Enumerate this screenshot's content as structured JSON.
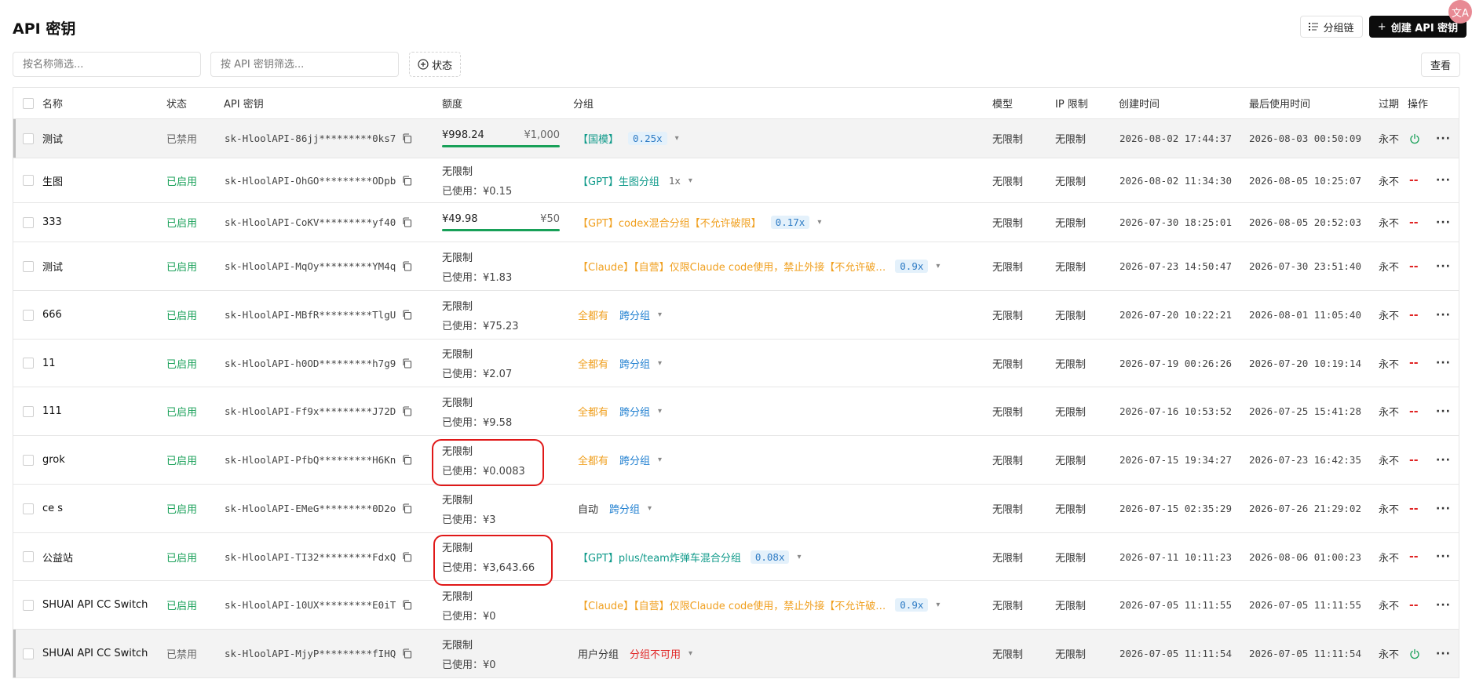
{
  "page": {
    "title": "API 密钥"
  },
  "toolbar": {
    "group_chain_label": "分组链",
    "create_label": "创建 API 密钥",
    "view_label": "查看",
    "translate_badge": "文A"
  },
  "filters": {
    "name_placeholder": "按名称筛选...",
    "key_placeholder": "按 API 密钥筛选...",
    "status_label": "状态"
  },
  "columns": [
    "名称",
    "状态",
    "API 密钥",
    "额度",
    "分组",
    "模型",
    "IP 限制",
    "创建时间",
    "最后使用时间",
    "过期",
    "操作"
  ],
  "rows": [
    {
      "name": "测试",
      "status": "已禁用",
      "enabled": false,
      "key": "sk-HloolAPI-86jj*********0ks7",
      "quota": {
        "mode": "bar",
        "remaining": "¥998.24",
        "total": "¥1,000",
        "fraction": 0.998
      },
      "group": {
        "parts": [
          {
            "text": "【国模】",
            "style": "teal"
          }
        ],
        "ratio": "0.25x",
        "ratio_style": "badge"
      },
      "model": "无限制",
      "ip": "无限制",
      "created": "2026-08-02 17:44:37",
      "last_used": "2026-08-03 00:50:09",
      "expires": "永不",
      "action": "power"
    },
    {
      "name": "生图",
      "status": "已启用",
      "enabled": true,
      "key": "sk-HloolAPI-OhGO*********ODpb",
      "quota": {
        "mode": "used",
        "limit": "无限制",
        "used": "已使用：¥0.15"
      },
      "group": {
        "parts": [
          {
            "text": "【GPT】生图分组",
            "style": "teal"
          }
        ],
        "ratio": "1x",
        "ratio_style": "plain"
      },
      "model": "无限制",
      "ip": "无限制",
      "created": "2026-08-02 11:34:30",
      "last_used": "2026-08-05 10:25:07",
      "expires": "永不",
      "action": "dash"
    },
    {
      "name": "333",
      "status": "已启用",
      "enabled": true,
      "key": "sk-HloolAPI-CoKV*********yf40",
      "quota": {
        "mode": "bar",
        "remaining": "¥49.98",
        "total": "¥50",
        "fraction": 0.9996
      },
      "group": {
        "parts": [
          {
            "text": "【GPT】codex混合分组【不允许破限】",
            "style": "orange"
          }
        ],
        "ratio": "0.17x",
        "ratio_style": "badge"
      },
      "model": "无限制",
      "ip": "无限制",
      "created": "2026-07-30 18:25:01",
      "last_used": "2026-08-05 20:52:03",
      "expires": "永不",
      "action": "dash"
    },
    {
      "name": "测试",
      "status": "已启用",
      "enabled": true,
      "key": "sk-HloolAPI-MqOy*********YM4q",
      "quota": {
        "mode": "used",
        "limit": "无限制",
        "used": "已使用：¥1.83"
      },
      "group": {
        "parts": [
          {
            "text": "【Claude】【自营】仅限Claude code使用，禁止外接【不允许破…",
            "style": "orange"
          }
        ],
        "ratio": "0.9x",
        "ratio_style": "badge"
      },
      "model": "无限制",
      "ip": "无限制",
      "created": "2026-07-23 14:50:47",
      "last_used": "2026-07-30 23:51:40",
      "expires": "永不",
      "action": "dash"
    },
    {
      "name": "666",
      "status": "已启用",
      "enabled": true,
      "key": "sk-HloolAPI-MBfR*********TlgU",
      "quota": {
        "mode": "used",
        "limit": "无限制",
        "used": "已使用：¥75.23"
      },
      "group": {
        "parts": [
          {
            "text": "全都有",
            "style": "orange"
          },
          {
            "text": "跨分组",
            "style": "blue"
          }
        ],
        "ratio": "",
        "ratio_style": "none"
      },
      "model": "无限制",
      "ip": "无限制",
      "created": "2026-07-20 10:22:21",
      "last_used": "2026-08-01 11:05:40",
      "expires": "永不",
      "action": "dash"
    },
    {
      "name": "11",
      "status": "已启用",
      "enabled": true,
      "key": "sk-HloolAPI-h0OD*********h7g9",
      "quota": {
        "mode": "used",
        "limit": "无限制",
        "used": "已使用：¥2.07"
      },
      "group": {
        "parts": [
          {
            "text": "全都有",
            "style": "orange"
          },
          {
            "text": "跨分组",
            "style": "blue"
          }
        ],
        "ratio": "",
        "ratio_style": "none"
      },
      "model": "无限制",
      "ip": "无限制",
      "created": "2026-07-19 00:26:26",
      "last_used": "2026-07-20 10:19:14",
      "expires": "永不",
      "action": "dash"
    },
    {
      "name": "111",
      "status": "已启用",
      "enabled": true,
      "key": "sk-HloolAPI-Ff9x*********J72D",
      "quota": {
        "mode": "used",
        "limit": "无限制",
        "used": "已使用：¥9.58"
      },
      "group": {
        "parts": [
          {
            "text": "全都有",
            "style": "orange"
          },
          {
            "text": "跨分组",
            "style": "blue"
          }
        ],
        "ratio": "",
        "ratio_style": "none"
      },
      "model": "无限制",
      "ip": "无限制",
      "created": "2026-07-16 10:53:52",
      "last_used": "2026-07-25 15:41:28",
      "expires": "永不",
      "action": "dash"
    },
    {
      "name": "grok",
      "status": "已启用",
      "enabled": true,
      "key": "sk-HloolAPI-PfbQ*********H6Kn",
      "quota": {
        "mode": "used",
        "limit": "无限制",
        "used": "已使用：¥0.0083"
      },
      "group": {
        "parts": [
          {
            "text": "全都有",
            "style": "orange"
          },
          {
            "text": "跨分组",
            "style": "blue"
          }
        ],
        "ratio": "",
        "ratio_style": "none"
      },
      "model": "无限制",
      "ip": "无限制",
      "created": "2026-07-15 19:34:27",
      "last_used": "2026-07-23 16:42:35",
      "expires": "永不",
      "action": "dash"
    },
    {
      "name": "ce s",
      "status": "已启用",
      "enabled": true,
      "key": "sk-HloolAPI-EMeG*********0D2o",
      "quota": {
        "mode": "used",
        "limit": "无限制",
        "used": "已使用：¥3"
      },
      "group": {
        "parts": [
          {
            "text": "自动",
            "style": "gray"
          },
          {
            "text": "跨分组",
            "style": "blue"
          }
        ],
        "ratio": "",
        "ratio_style": "none"
      },
      "model": "无限制",
      "ip": "无限制",
      "created": "2026-07-15 02:35:29",
      "last_used": "2026-07-26 21:29:02",
      "expires": "永不",
      "action": "dash"
    },
    {
      "name": "公益站",
      "status": "已启用",
      "enabled": true,
      "key": "sk-HloolAPI-TI32*********FdxQ",
      "quota": {
        "mode": "used",
        "limit": "无限制",
        "used": "已使用：¥3,643.66"
      },
      "group": {
        "parts": [
          {
            "text": "【GPT】plus/team炸弹车混合分组",
            "style": "teal"
          }
        ],
        "ratio": "0.08x",
        "ratio_style": "badge"
      },
      "model": "无限制",
      "ip": "无限制",
      "created": "2026-07-11 10:11:23",
      "last_used": "2026-08-06 01:00:23",
      "expires": "永不",
      "action": "dash"
    },
    {
      "name": "SHUAI API CC Switch",
      "status": "已启用",
      "enabled": true,
      "key": "sk-HloolAPI-10UX*********E0iT",
      "quota": {
        "mode": "used",
        "limit": "无限制",
        "used": "已使用：¥0"
      },
      "group": {
        "parts": [
          {
            "text": "【Claude】【自营】仅限Claude code使用，禁止外接【不允许破…",
            "style": "orange"
          }
        ],
        "ratio": "0.9x",
        "ratio_style": "badge"
      },
      "model": "无限制",
      "ip": "无限制",
      "created": "2026-07-05 11:11:55",
      "last_used": "2026-07-05 11:11:55",
      "expires": "永不",
      "action": "dash"
    },
    {
      "name": "SHUAI API CC Switch",
      "status": "已禁用",
      "enabled": false,
      "key": "sk-HloolAPI-MjyP*********fIHQ",
      "quota": {
        "mode": "used",
        "limit": "无限制",
        "used": "已使用：¥0"
      },
      "group": {
        "parts": [
          {
            "text": "用户分组",
            "style": "gray"
          },
          {
            "text": "分组不可用",
            "style": "red"
          }
        ],
        "ratio": "",
        "ratio_style": "none"
      },
      "model": "无限制",
      "ip": "无限制",
      "created": "2026-07-05 11:11:54",
      "last_used": "2026-07-05 11:11:54",
      "expires": "永不",
      "action": "power"
    }
  ],
  "actions": {
    "dash_symbol": "--",
    "more_symbol": "···"
  },
  "colors": {
    "enabled": "#18a058",
    "teal_group": "#0f9a8a",
    "orange_group": "#f0a020",
    "blue_group": "#1f7fd0",
    "red_group": "#e02424",
    "highlight_circle": "#e01818"
  },
  "icons": {
    "copy": "copy-icon",
    "power": "power-icon",
    "plus": "plus-icon",
    "status_filter": "plus-circle-icon",
    "group_chain": "list-icon",
    "expand": "chevron-down-icon"
  }
}
